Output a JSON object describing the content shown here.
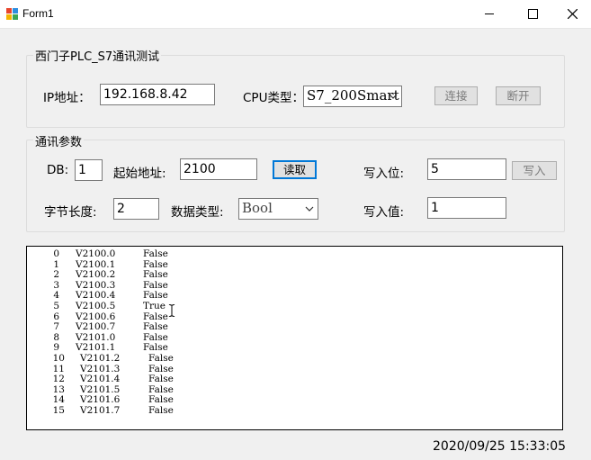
{
  "window": {
    "title": "Form1",
    "minimize_icon": "minimize-icon",
    "maximize_icon": "maximize-icon",
    "close_icon": "close-icon"
  },
  "connection_group": {
    "title": "西门子PLC_S7通讯测试",
    "ip_label": "IP地址：",
    "ip_value": "192.168.8.42",
    "cpu_label": "CPU类型：",
    "cpu_value": "S7_200Smart",
    "connect_label": "连接",
    "disconnect_label": "断开"
  },
  "params_group": {
    "title": "通讯参数",
    "db_label": "DB:",
    "db_value": "1",
    "start_addr_label": "起始地址:",
    "start_addr_value": "2100",
    "read_label": "读取",
    "write_bit_label": "写入位:",
    "write_bit_value": "5",
    "write_label": "写入",
    "byte_len_label": "字节长度:",
    "byte_len_value": "2",
    "data_type_label": "数据类型:",
    "data_type_value": "Bool",
    "write_value_label": "写入值:",
    "write_value_value": "1"
  },
  "output": {
    "rows": [
      {
        "idx": "0",
        "addr": "V2100.0",
        "val": "False"
      },
      {
        "idx": "1",
        "addr": "V2100.1",
        "val": "False"
      },
      {
        "idx": "2",
        "addr": "V2100.2",
        "val": "False"
      },
      {
        "idx": "3",
        "addr": "V2100.3",
        "val": "False"
      },
      {
        "idx": "4",
        "addr": "V2100.4",
        "val": "False"
      },
      {
        "idx": "5",
        "addr": "V2100.5",
        "val": "True"
      },
      {
        "idx": "6",
        "addr": "V2100.6",
        "val": "False"
      },
      {
        "idx": "7",
        "addr": "V2100.7",
        "val": "False"
      },
      {
        "idx": "8",
        "addr": "V2101.0",
        "val": "False"
      },
      {
        "idx": "9",
        "addr": "V2101.1",
        "val": "False"
      },
      {
        "idx": "10",
        "addr": "V2101.2",
        "val": "False"
      },
      {
        "idx": "11",
        "addr": "V2101.3",
        "val": "False"
      },
      {
        "idx": "12",
        "addr": "V2101.4",
        "val": "False"
      },
      {
        "idx": "13",
        "addr": "V2101.5",
        "val": "False"
      },
      {
        "idx": "14",
        "addr": "V2101.6",
        "val": "False"
      },
      {
        "idx": "15",
        "addr": "V2101.7",
        "val": "False"
      }
    ]
  },
  "status": {
    "datetime": "2020/09/25 15:33:05"
  }
}
